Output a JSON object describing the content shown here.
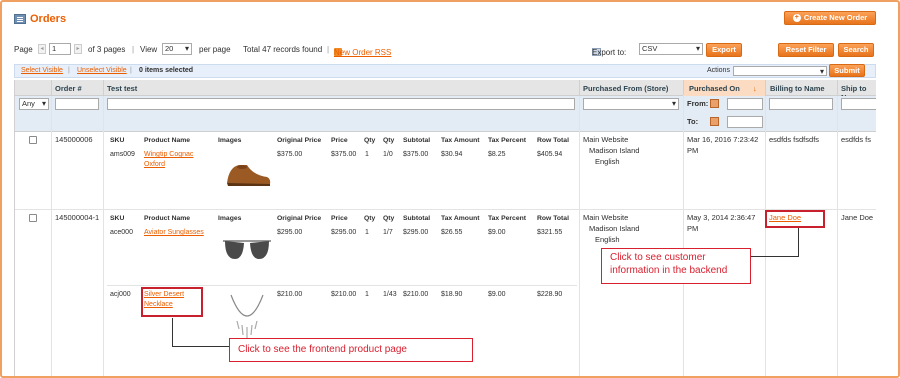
{
  "title": "Orders",
  "new_order": "Create New Order",
  "toolbar": {
    "page_label": "Page",
    "page_value": "1",
    "of_pages": "of 3 pages",
    "view_label": "View",
    "view_value": "20",
    "per_page": "per page",
    "total": "Total 47 records found",
    "rss": "New Order RSS",
    "export_label": "Export to:",
    "export_value": "CSV",
    "export_btn": "Export",
    "reset_btn": "Reset Filter",
    "search_btn": "Search"
  },
  "massbar": {
    "select_visible": "Select Visible",
    "unselect_visible": "Unselect Visible",
    "items_selected": "0 items selected",
    "actions_label": "Actions",
    "submit": "Submit"
  },
  "columns": {
    "order": "Order #",
    "test": "Test test",
    "purchased_from": "Purchased From (Store)",
    "purchased_on": "Purchased On",
    "billing": "Billing to Name",
    "ship": "Ship to Na"
  },
  "filters": {
    "any": "Any",
    "from": "From:",
    "to": "To:"
  },
  "sub_headers": [
    "SKU",
    "Product Name",
    "Images",
    "Original Price",
    "Price",
    "Qty",
    "Qty",
    "Subtotal",
    "Tax Amount",
    "Tax Percent",
    "Row Total"
  ],
  "orders": [
    {
      "id": "145000006",
      "store": [
        "Main Website",
        "Madison Island",
        "English"
      ],
      "date": "Mar 16, 2016 7:23:42 PM",
      "billing": "esdfds fsdfsdfs",
      "ship": "esdfds fs",
      "items": [
        {
          "sku": "ams009",
          "name": "Wingtip Cognac Oxford",
          "orig": "$375.00",
          "price": "$375.00",
          "qty": "1",
          "qty2": "1/0",
          "subtotal": "$375.00",
          "tax": "$30.94",
          "taxp": "$8.25",
          "total": "$405.94"
        }
      ]
    },
    {
      "id": "145000004-1",
      "store": [
        "Main Website",
        "Madison Island",
        "English"
      ],
      "date": "May 3, 2014 2:36:47 PM",
      "billing": "Jane Doe",
      "ship": "Jane Doe",
      "items": [
        {
          "sku": "ace000",
          "name": "Aviator Sunglasses",
          "orig": "$295.00",
          "price": "$295.00",
          "qty": "1",
          "qty2": "1/7",
          "subtotal": "$295.00",
          "tax": "$26.55",
          "taxp": "$9.00",
          "total": "$321.55"
        },
        {
          "sku": "acj000",
          "name": "Silver Desert Necklace",
          "orig": "$210.00",
          "price": "$210.00",
          "qty": "1",
          "qty2": "1/43",
          "subtotal": "$210.00",
          "tax": "$18.90",
          "taxp": "$9.00",
          "total": "$228.90"
        }
      ]
    }
  ],
  "notes": {
    "customer": "Click to see customer information in the backend",
    "frontend": "Click to see the frontend product page"
  }
}
